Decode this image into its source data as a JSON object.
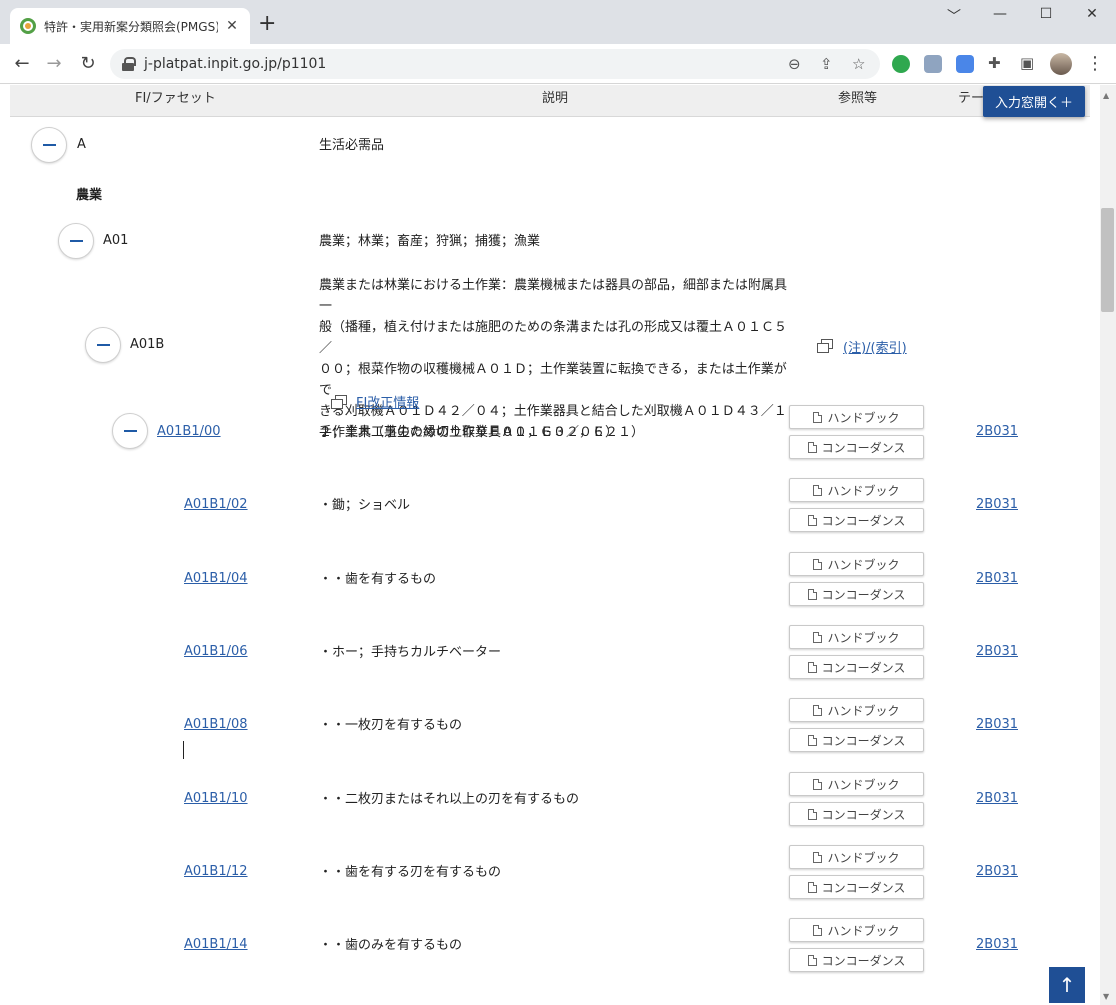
{
  "browser": {
    "tab_title": "特許・実用新案分類照会(PMGS) | ",
    "tab_close": "✕",
    "new_tab": "+",
    "url": "j-platpat.inpit.go.jp/p1101",
    "win_minimize": "﹀",
    "win_min": "—",
    "win_max": "☐",
    "win_close": "✕"
  },
  "header": {
    "col_fi": "FI/ファセット",
    "col_desc": "説明",
    "col_ref": "参照等",
    "col_theme": "テー",
    "open_input": "入力窓開く＋"
  },
  "tree": {
    "a": {
      "code": "A",
      "desc": "生活必需品"
    },
    "section": "農業",
    "a01": {
      "code": "A01",
      "desc": "農業；林業；畜産；狩猟；捕獲；漁業"
    },
    "a01b": {
      "code": "A01B",
      "desc_lines": [
        "農業または林業における土作業：農業機械または器具の部品，細部または附属具一",
        "般（播種，植え付けまたは施肥のための条溝または孔の形成又は覆土Ａ０１Ｃ５／",
        "００；根菜作物の収穫機械Ａ０１Ｄ；土作業装置に転換できる，または土作業がで",
        "きる刈取機Ａ０１Ｄ４２／０４；土作業器具と結合した刈取機Ａ０１Ｄ４３／１",
        "２；土木工事のための土作業Ｅ０１，Ｅ０２，Ｅ２１）"
      ],
      "ref_link": "(注)/(索引)",
      "fi_revision": "FI改正情報"
    }
  },
  "buttons": {
    "handbook": "ハンドブック",
    "concordance": "コンコーダンス"
  },
  "entries": [
    {
      "code": "A01B1/00",
      "desc": "手作業具（芝生の縁切り取り具Ａ０１Ｇ３／０６）",
      "theme": "2B031"
    },
    {
      "code": "A01B1/02",
      "desc": "・鋤；ショベル",
      "theme": "2B031"
    },
    {
      "code": "A01B1/04",
      "desc": "・・歯を有するもの",
      "theme": "2B031"
    },
    {
      "code": "A01B1/06",
      "desc": "・ホー；手持ちカルチベーター",
      "theme": "2B031"
    },
    {
      "code": "A01B1/08",
      "desc": "・・一枚刃を有するもの",
      "theme": "2B031"
    },
    {
      "code": "A01B1/10",
      "desc": "・・二枚刃またはそれ以上の刃を有するもの",
      "theme": "2B031"
    },
    {
      "code": "A01B1/12",
      "desc": "・・歯を有する刃を有するもの",
      "theme": "2B031"
    },
    {
      "code": "A01B1/14",
      "desc": "・・歯のみを有するもの",
      "theme": "2B031"
    }
  ],
  "scroll_top": "↑",
  "icons": {
    "back": "arrow-left-icon",
    "forward": "arrow-right-icon",
    "reload": "reload-icon",
    "zoom": "zoom-out-icon",
    "share": "share-icon",
    "bookmark": "star-icon",
    "extensions": "puzzle-icon",
    "sidepanel": "side-panel-icon",
    "menu": "more-vert-icon"
  },
  "colors": {
    "accent": "#1f4f95",
    "link": "#2b5ea8",
    "header_bg": "#efefef"
  }
}
